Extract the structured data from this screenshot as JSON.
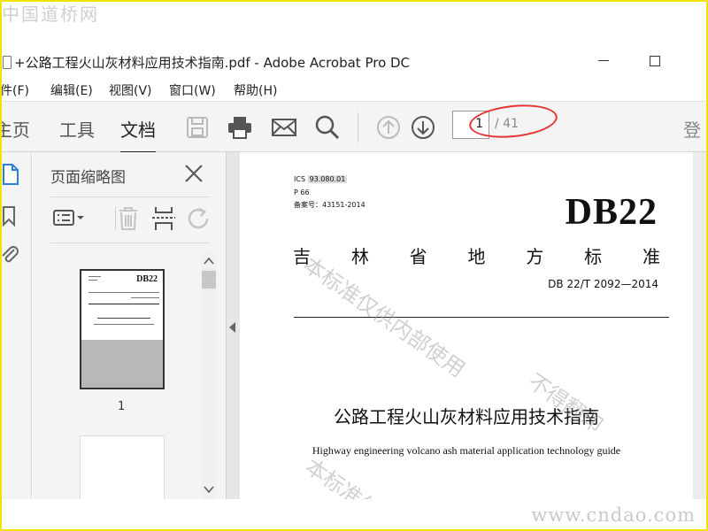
{
  "watermarks": {
    "top": "中国道桥网",
    "bottom": "www.cndao.com"
  },
  "window": {
    "title": "+公路工程火山灰材料应用技术指南.pdf - Adobe Acrobat Pro DC"
  },
  "menu": [
    "件(F)",
    "编辑(E)",
    "视图(V)",
    "窗口(W)",
    "帮助(H)"
  ],
  "toolbar": {
    "tabs": [
      "主页",
      "工具",
      "文档"
    ],
    "active_tab": "文档",
    "icons": [
      "save-icon",
      "print-icon",
      "mail-icon",
      "search-icon",
      "prev-page-icon",
      "next-page-icon"
    ],
    "page_current": "1",
    "page_total": "/ 41",
    "right_partial": "登"
  },
  "side_panel": {
    "title": "页面缩略图",
    "thumbnail_page_number": "1",
    "thumb_db": "DB22"
  },
  "document": {
    "ics_label": "ICS",
    "ics_code": "93.080.01",
    "p_code": "P 66",
    "record_no": "备案号：43151-2014",
    "db_code": "DB22",
    "province_chars": [
      "吉",
      "林",
      "省",
      "地",
      "方",
      "标",
      "准"
    ],
    "standard_code": "DB 22/T 2092—2014",
    "title_cn": "公路工程火山灰材料应用技术指南",
    "title_en": "Highway engineering volcano ash material application technology guide",
    "stamp_1": "本标准仅供内部使用",
    "stamp_2": "不得翻印",
    "stamp_3": "本标准仅"
  },
  "colors": {
    "highlight_ellipse": "#e63232",
    "frame": "#f2e200"
  }
}
